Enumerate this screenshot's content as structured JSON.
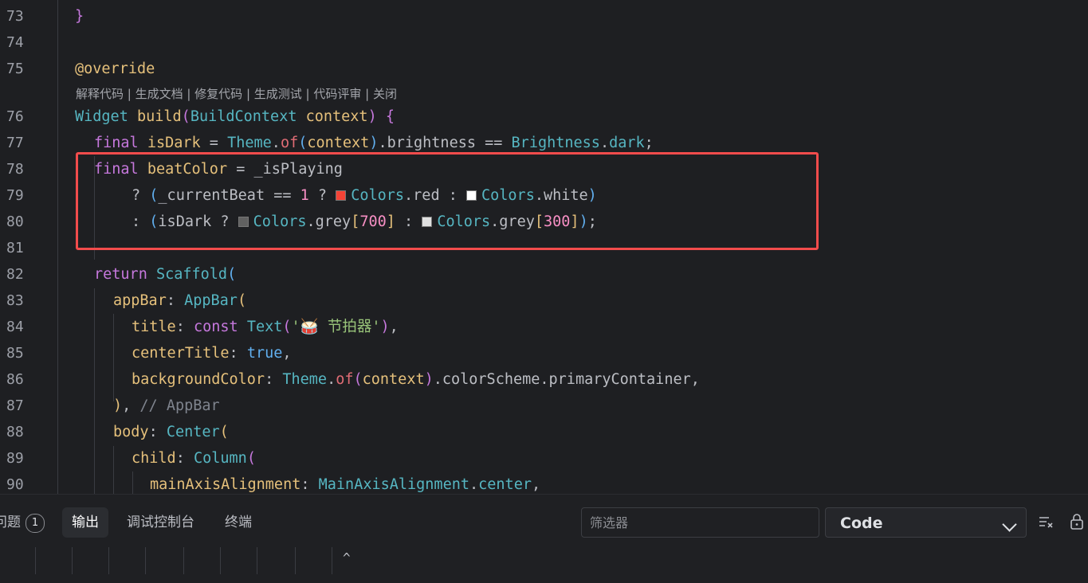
{
  "editor": {
    "codelens": "解释代码 | 生成文档 | 修复代码 | 生成测试 | 代码评审 | 关闭",
    "line_numbers": [
      "73",
      "74",
      "75",
      "76",
      "77",
      "78",
      "79",
      "80",
      "81",
      "82",
      "83",
      "84",
      "85",
      "86",
      "87",
      "88",
      "89",
      "90"
    ],
    "line73": "}",
    "line75": "@override",
    "l76": {
      "a": "Widget",
      "b": "build",
      "c": "(",
      "d": "BuildContext",
      "e": "context",
      "f": ")",
      "g": " {"
    },
    "l77": {
      "a": "final",
      "b": "isDark",
      "c": " = ",
      "d": "Theme",
      "e": ".",
      "f": "of",
      "g": "(",
      "h": "context",
      "i": ")",
      "j": ".brightness == ",
      "k": "Brightness",
      "l": ".",
      "m": "dark",
      "n": ";"
    },
    "l78": {
      "a": "final",
      "b": "beatColor",
      "c": " = _isPlaying"
    },
    "l79": {
      "a": "? ",
      "b": "(",
      "c": "_currentBeat == ",
      "d": "1",
      "e": " ? ",
      "f": "Colors",
      "g": ".red : ",
      "h": "Colors",
      "i": ".white",
      "j": ")"
    },
    "l80": {
      "a": ": ",
      "b": "(",
      "c": "isDark ? ",
      "d": "Colors",
      "e": ".grey",
      "f": "[",
      "g": "700",
      "h": "]",
      "i": " : ",
      "j": "Colors",
      "k": ".grey",
      "l": "[",
      "m": "300",
      "n": "]",
      "o": ")",
      "p": ";"
    },
    "l82": {
      "a": "return",
      "b": "Scaffold",
      "c": "("
    },
    "l83": {
      "a": "appBar",
      "b": ": ",
      "c": "AppBar",
      "d": "("
    },
    "l84": {
      "a": "title",
      "b": ": ",
      "c": "const",
      "d": "Text",
      "e": "(",
      "f": "'🥁 节拍器'",
      "g": ")",
      "h": ","
    },
    "l85": {
      "a": "centerTitle",
      "b": ": ",
      "c": "true",
      "d": ","
    },
    "l86": {
      "a": "backgroundColor",
      "b": ": ",
      "c": "Theme",
      "d": ".",
      "e": "of",
      "f": "(",
      "g": "context",
      "h": ")",
      "i": ".colorScheme.primaryContainer,"
    },
    "l87": {
      "a": ")",
      "b": ", ",
      "c": "// AppBar"
    },
    "l88": {
      "a": "body",
      "b": ": ",
      "c": "Center",
      "d": "("
    },
    "l89": {
      "a": "child",
      "b": ": ",
      "c": "Column",
      "d": "("
    },
    "l90": {
      "a": "mainAxisAlignment",
      "b": ": ",
      "c": "MainAxisAlignment",
      "d": ".",
      "e": "center",
      "f": ","
    }
  },
  "swatches": {
    "red": "#f44336",
    "white": "#ffffff",
    "grey700": "#616161",
    "grey300": "#e0e0e0"
  },
  "highlight_color": "#f24c4c",
  "panel": {
    "tab_problems": "问题",
    "problems_count": "1",
    "tab_output": "输出",
    "tab_debug": "调试控制台",
    "tab_terminal": "终端",
    "filter_placeholder": "筛选器",
    "select_value": "Code",
    "caret": "^"
  },
  "icons": [
    "chevron-down-icon",
    "clear-output-icon",
    "lock-icon"
  ]
}
